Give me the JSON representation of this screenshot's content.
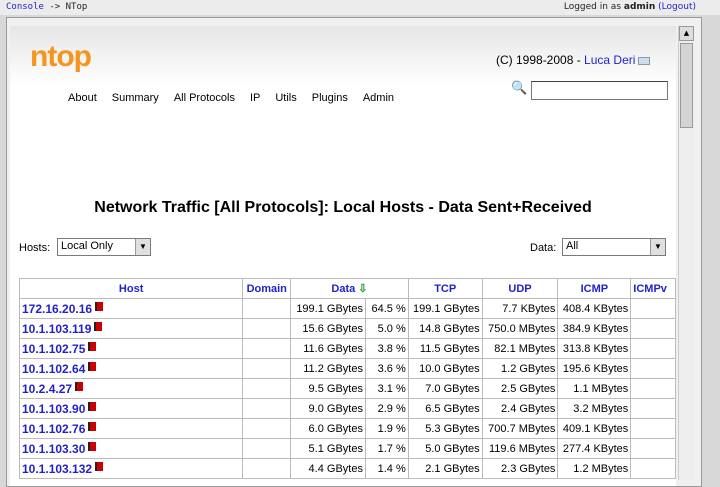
{
  "topbar": {
    "console": "Console",
    "arrow": "-> NTop",
    "logged_in": "Logged in as ",
    "user": "admin",
    "logout": "Logout"
  },
  "header": {
    "logo": "ntop",
    "copyright": "(C) 1998-2008 - ",
    "author": "Luca Deri"
  },
  "menu": [
    "About",
    "Summary",
    "All Protocols",
    "IP",
    "Utils",
    "Plugins",
    "Admin"
  ],
  "title": "Network Traffic [All Protocols]: Local Hosts - Data Sent+Received",
  "filters": {
    "hosts_label": "Hosts:",
    "hosts_value": "Local Only",
    "data_label": "Data:",
    "data_value": "All"
  },
  "table": {
    "headers": [
      "Host",
      "Domain",
      "Data",
      "TCP",
      "UDP",
      "ICMP",
      "ICMPv"
    ],
    "rows": [
      {
        "host": "172.16.20.16",
        "data": "199.1 GBytes",
        "pct": "64.5 %",
        "tcp": "199.1 GBytes",
        "udp": "7.7 KBytes",
        "icmp": "408.4 KBytes"
      },
      {
        "host": "10.1.103.119",
        "data": "15.6 GBytes",
        "pct": "5.0 %",
        "tcp": "14.8 GBytes",
        "udp": "750.0 MBytes",
        "icmp": "384.9 KBytes"
      },
      {
        "host": "10.1.102.75",
        "data": "11.6 GBytes",
        "pct": "3.8 %",
        "tcp": "11.5 GBytes",
        "udp": "82.1 MBytes",
        "icmp": "313.8 KBytes"
      },
      {
        "host": "10.1.102.64",
        "data": "11.2 GBytes",
        "pct": "3.6 %",
        "tcp": "10.0 GBytes",
        "udp": "1.2 GBytes",
        "icmp": "195.6 KBytes"
      },
      {
        "host": "10.2.4.27",
        "data": "9.5 GBytes",
        "pct": "3.1 %",
        "tcp": "7.0 GBytes",
        "udp": "2.5 GBytes",
        "icmp": "1.1 MBytes"
      },
      {
        "host": "10.1.103.90",
        "data": "9.0 GBytes",
        "pct": "2.9 %",
        "tcp": "6.5 GBytes",
        "udp": "2.4 GBytes",
        "icmp": "3.2 MBytes"
      },
      {
        "host": "10.1.102.76",
        "data": "6.0 GBytes",
        "pct": "1.9 %",
        "tcp": "5.3 GBytes",
        "udp": "700.7 MBytes",
        "icmp": "409.1 KBytes"
      },
      {
        "host": "10.1.103.30",
        "data": "5.1 GBytes",
        "pct": "1.7 %",
        "tcp": "5.0 GBytes",
        "udp": "119.6 MBytes",
        "icmp": "277.4 KBytes"
      },
      {
        "host": "10.1.103.132",
        "data": "4.4 GBytes",
        "pct": "1.4 %",
        "tcp": "2.1 GBytes",
        "udp": "2.3 GBytes",
        "icmp": "1.2 MBytes"
      }
    ]
  }
}
